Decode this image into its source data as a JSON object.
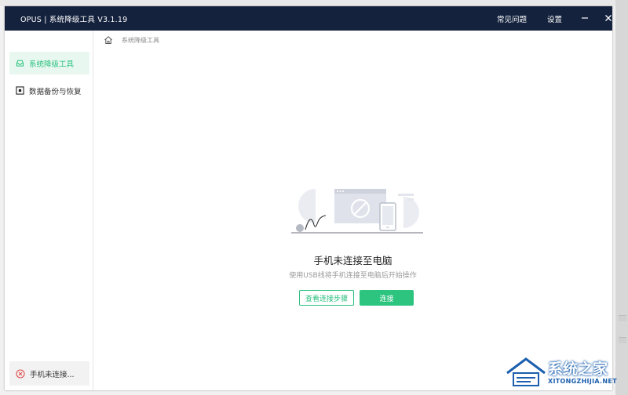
{
  "window": {
    "title": "OPUS | 系统降级工具  V3.1.19",
    "nav": {
      "faq": "常见问题",
      "settings": "设置"
    }
  },
  "sidebar": {
    "items": [
      {
        "label": "系统降级工具",
        "icon": "inbox-icon",
        "active": true
      },
      {
        "label": "数据备份与恢复",
        "icon": "square-plus-icon",
        "active": false
      }
    ],
    "status": {
      "label": "手机未连接...",
      "icon": "error-circle-icon"
    }
  },
  "breadcrumb": {
    "label": "系统降级工具"
  },
  "empty_state": {
    "title": "手机未连接至电脑",
    "subtitle": "使用USB线将手机连接至电脑后开始操作",
    "view_steps_label": "查看连接步骤",
    "connect_label": "连接"
  },
  "watermark": {
    "cn": "系统之家",
    "en": "XITONGZHIJIA.NET"
  },
  "colors": {
    "titlebar": "#14223d",
    "accent": "#2bc07e",
    "error": "#e04b4b"
  }
}
